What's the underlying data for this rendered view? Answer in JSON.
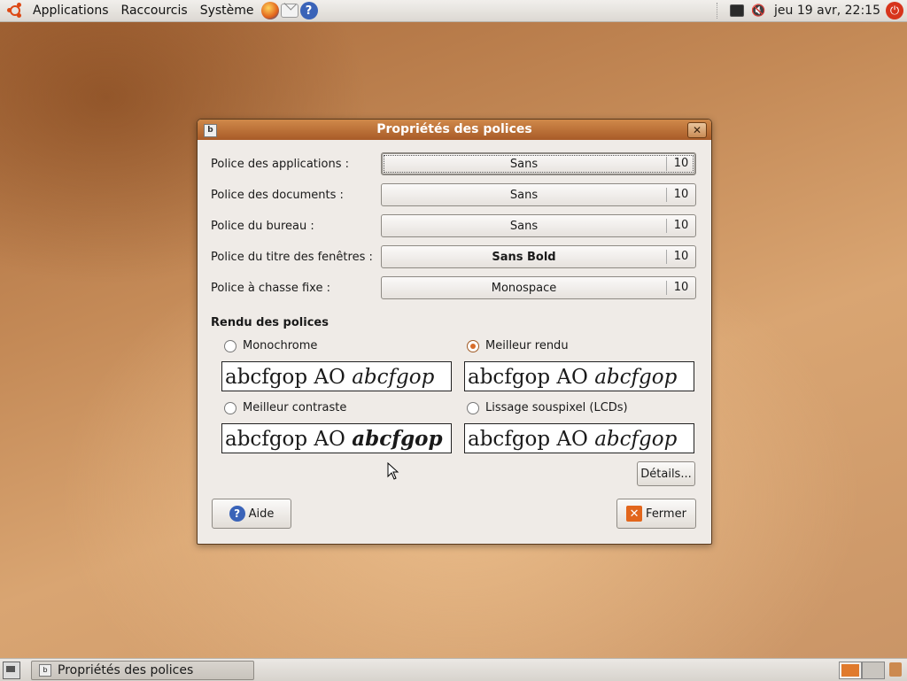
{
  "top_panel": {
    "menus": [
      "Applications",
      "Raccourcis",
      "Système"
    ],
    "clock": "jeu 19 avr, 22:15"
  },
  "dialog": {
    "title": "Propriétés des polices",
    "fonts": [
      {
        "label": "Police des applications :",
        "font": "Sans",
        "size": "10"
      },
      {
        "label": "Police des documents :",
        "font": "Sans",
        "size": "10"
      },
      {
        "label": "Police du bureau :",
        "font": "Sans",
        "size": "10"
      },
      {
        "label": "Police du titre des fenêtres :",
        "font": "Sans Bold",
        "size": "10"
      },
      {
        "label": "Police à chasse fixe :",
        "font": "Monospace",
        "size": "10"
      }
    ],
    "rendering": {
      "title": "Rendu des polices",
      "options": [
        {
          "label": "Monochrome",
          "checked": false
        },
        {
          "label": "Meilleur rendu",
          "checked": true
        },
        {
          "label": "Meilleur contraste",
          "checked": false
        },
        {
          "label": "Lissage souspixel (LCDs)",
          "checked": false
        }
      ],
      "sample_plain": "abcfgop AO ",
      "sample_italic": "abcfgop"
    },
    "details_label": "Détails...",
    "help_label": "Aide",
    "close_label": "Fermer"
  },
  "bottom_panel": {
    "task_label": "Propriétés des polices"
  },
  "colors": {
    "titlebar": "#c07034",
    "accent": "#d86d2a",
    "help_blue": "#3a63b8"
  }
}
